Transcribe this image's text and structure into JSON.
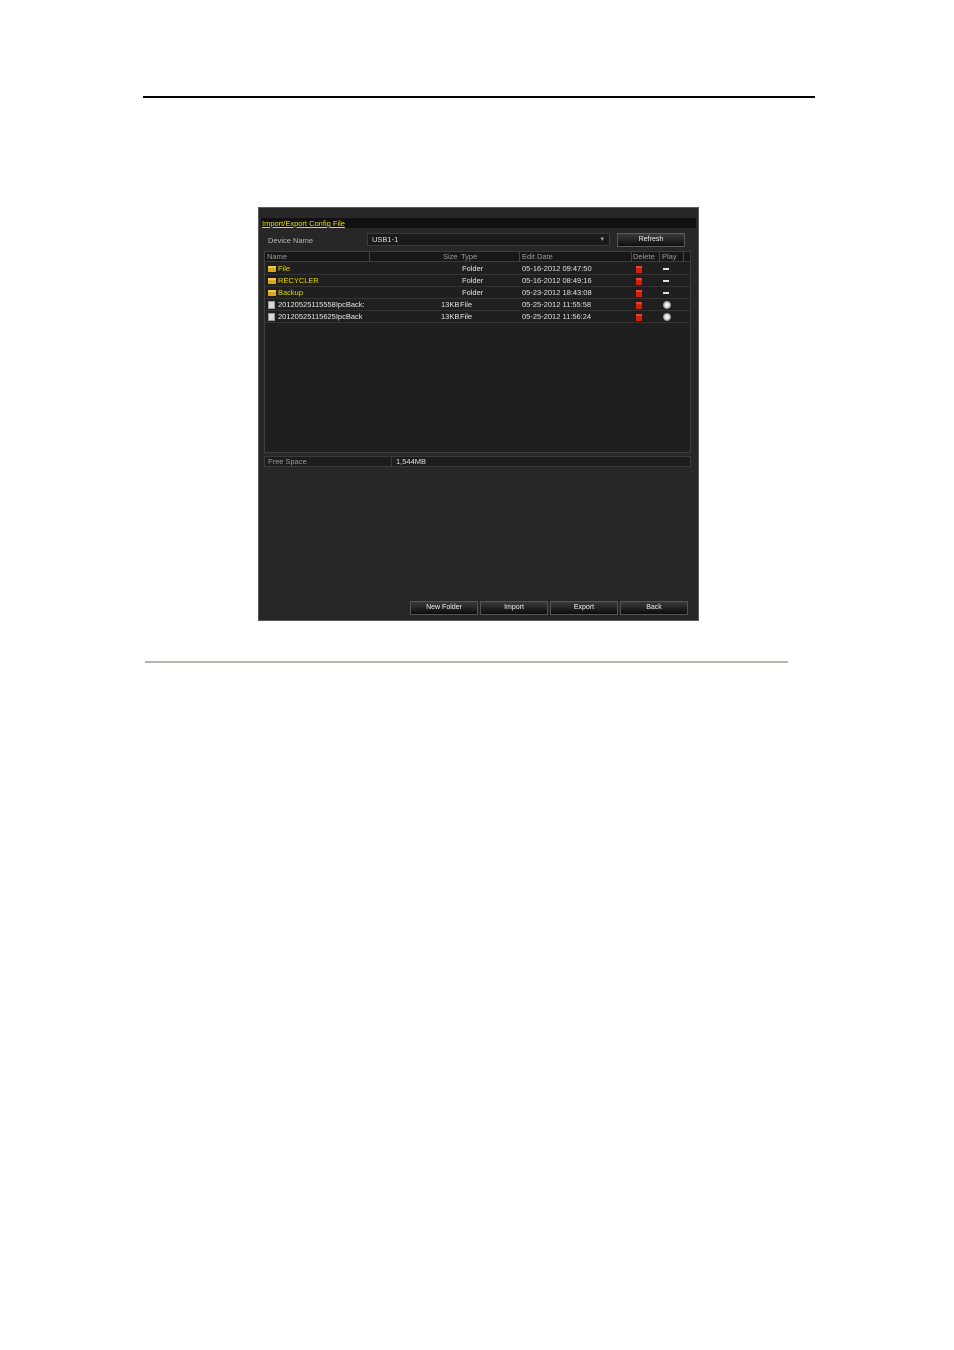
{
  "window": {
    "title": "Import/Export Config File"
  },
  "device": {
    "label": "Device Name",
    "selected": "USB1-1",
    "refresh_label": "Refresh"
  },
  "table": {
    "headers": {
      "name": "Name",
      "size": "Size",
      "type": "Type",
      "edit_date": "Edit Date",
      "delete": "Delete",
      "play": "Play"
    },
    "rows": [
      {
        "name": "File",
        "size": "",
        "type": "Folder",
        "edit_date": "05-16-2012 09:47:50",
        "kind": "folder",
        "play": "dash"
      },
      {
        "name": "RECYCLER",
        "size": "",
        "type": "Folder",
        "edit_date": "05-16-2012 08:49:16",
        "kind": "folder",
        "play": "dash"
      },
      {
        "name": "Backup",
        "size": "",
        "type": "Folder",
        "edit_date": "05-23-2012 18:43:08",
        "kind": "folder",
        "play": "dash"
      },
      {
        "name": "20120525115558IpcBack:",
        "size": "13KB",
        "type": "File",
        "edit_date": "05-25-2012 11:55:58",
        "kind": "file",
        "play": "play"
      },
      {
        "name": "20120525115625IpcBack",
        "size": "13KB",
        "type": "File",
        "edit_date": "05-25-2012 11:56:24",
        "kind": "file",
        "play": "play"
      }
    ]
  },
  "freespace": {
    "label": "Free Space",
    "value": "1,544MB"
  },
  "buttons": {
    "new_folder": "New Folder",
    "import": "Import",
    "export": "Export",
    "back": "Back"
  }
}
